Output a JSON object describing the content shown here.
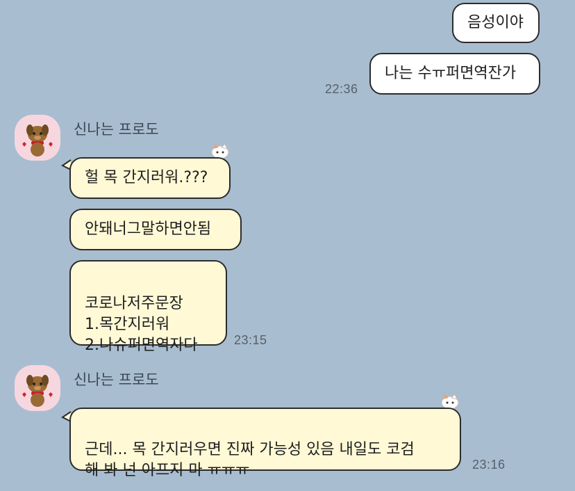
{
  "messages_me": {
    "m1": "음성이야",
    "m2": "나는 수ㅠ퍼면역잔가",
    "time": "22:36"
  },
  "group1": {
    "sender": "신나는 프로도",
    "b1": "헐 목 간지러워.???",
    "b2": "안돼너그말하면안됨",
    "b3": "코로나저주문장\n1.목간지러워\n2.나슈퍼면역자다",
    "time": "23:15"
  },
  "group2": {
    "sender": "신나는 프로도",
    "b1": "근데... 목 간지러우면 진짜 가능성 있음 내일도 코검\n해 봐 넌 아프지 마 ㅠㅠㅠ",
    "time": "23:16"
  },
  "colors": {
    "background": "#a9bdd0",
    "my_bubble": "#ffffff",
    "friend_bubble": "#fff9d6",
    "avatar_bg": "#f7d7df"
  },
  "icons": {
    "avatar": "brown-dog-character-icon",
    "reaction": "cat-sticker-icon"
  }
}
